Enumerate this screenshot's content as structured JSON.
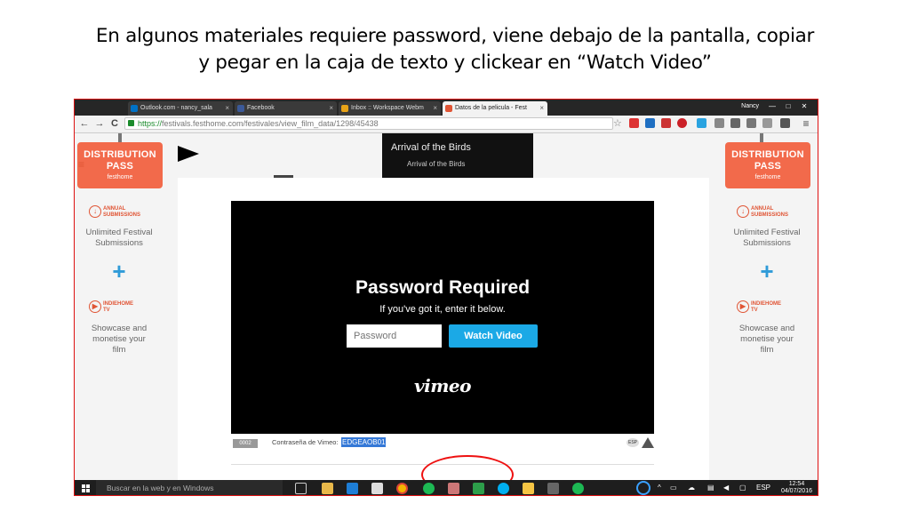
{
  "slide": {
    "title_line1": "En algunos materiales requiere password, viene debajo de la pantalla, copiar",
    "title_line2": "y pegar en la caja de texto y clickear en “Watch Video”"
  },
  "browser": {
    "tabs": [
      {
        "label": "Outlook.com - nancy_sala",
        "icon_color": "#0072c6"
      },
      {
        "label": "Facebook",
        "icon_color": "#3b5998"
      },
      {
        "label": "Inbox :: Workspace Webm",
        "icon_color": "#e8a317"
      },
      {
        "label": "Datos de la pelicula - Fest",
        "icon_color": "#e05535",
        "active": true
      }
    ],
    "user": "Nancy",
    "url_scheme": "https://",
    "url_rest": "festivals.festhome.com/festivales/view_film_data/1298/45438"
  },
  "sidebar": {
    "distribution_line1": "DISTRIBUTION",
    "distribution_line2": "PASS",
    "brand": "festhome",
    "annual_line1": "ANNUAL",
    "annual_line2": "SUBMISSIONS",
    "unlimited": "Unlimited Festival Submissions",
    "plus": "+",
    "indie_line1": "INDIEHOME",
    "indie_line2": "TV",
    "showcase": "Showcase and monetise your film"
  },
  "banner": {
    "title": "Arrival of the Birds",
    "subtitle": "Arrival of the Birds"
  },
  "player": {
    "heading": "Password Required",
    "subheading": "If you've got it, enter it below.",
    "password_placeholder": "Password",
    "watch_button": "Watch Video",
    "logo": "vimeo"
  },
  "meta": {
    "code": "0002",
    "password_label": "Contraseña de Vimeo:",
    "password_value": "EDGEAOB01",
    "language": "ESP"
  },
  "taskbar": {
    "search_placeholder": "Buscar en la web y en Windows",
    "language": "ESP",
    "time": "12:54",
    "date": "04/07/2016"
  }
}
